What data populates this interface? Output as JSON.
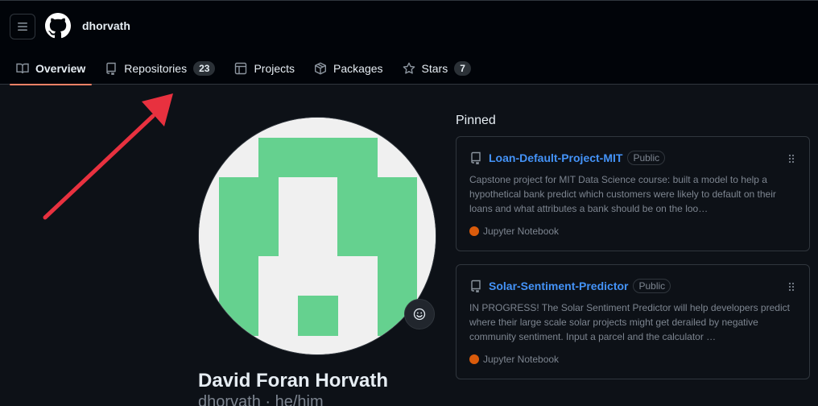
{
  "header": {
    "username": "dhorvath",
    "menu_icon": "hamburger-icon",
    "logo_icon": "github-logo-icon"
  },
  "tabs": [
    {
      "label": "Overview",
      "icon": "book-icon",
      "active": true
    },
    {
      "label": "Repositories",
      "icon": "repo-icon",
      "count": "23"
    },
    {
      "label": "Projects",
      "icon": "table-icon"
    },
    {
      "label": "Packages",
      "icon": "package-icon"
    },
    {
      "label": "Stars",
      "icon": "star-icon",
      "count": "7"
    }
  ],
  "profile": {
    "full_name": "David Foran Horvath",
    "handle_line": "dhorvath · he/him",
    "status_icon": "smiley-icon"
  },
  "pinned": {
    "title": "Pinned",
    "repos": [
      {
        "name": "Loan-Default-Project-MIT",
        "visibility": "Public",
        "description": "Capstone project for MIT Data Science course: built a model to help a hypothetical bank predict which customers were likely to default on their loans and what attributes a bank should be on the loo…",
        "language": "Jupyter Notebook",
        "language_color": "#DA5B0B"
      },
      {
        "name": "Solar-Sentiment-Predictor",
        "visibility": "Public",
        "description": "IN PROGRESS! The Solar Sentiment Predictor will help developers predict where their large scale solar projects might get derailed by negative community sentiment. Input a parcel and the calculator …",
        "language": "Jupyter Notebook",
        "language_color": "#DA5B0B"
      }
    ]
  },
  "colors": {
    "accent_link": "#4493f8",
    "tab_underline": "#f78166",
    "annotation_arrow": "#e8313f",
    "avatar_green": "#65d18f"
  }
}
